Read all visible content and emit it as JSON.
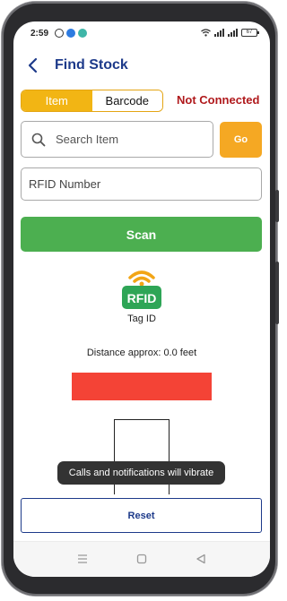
{
  "status_bar": {
    "time": "2:59",
    "battery": "67"
  },
  "header": {
    "back_icon": "chevron-left-icon",
    "title": "Find Stock"
  },
  "mode_toggle": {
    "options": [
      "Item",
      "Barcode"
    ],
    "selected": "Item"
  },
  "connection_status": "Not Connected",
  "search": {
    "placeholder": "Search Item",
    "value": "",
    "go_label": "Go"
  },
  "rfid": {
    "placeholder": "RFID Number",
    "value": ""
  },
  "scan_label": "Scan",
  "tag": {
    "logo_text": "RFID",
    "label": "Tag ID"
  },
  "distance_text": "Distance approx: 0.0 feet",
  "toast_text": "Calls and notifications will vibrate",
  "reset_label": "Reset",
  "colors": {
    "accent_yellow": "#f2b514",
    "go_orange": "#f5a823",
    "scan_green": "#4caf50",
    "status_red": "#b0191c",
    "signal_red": "#f44336",
    "title_blue": "#1d3a8a"
  }
}
